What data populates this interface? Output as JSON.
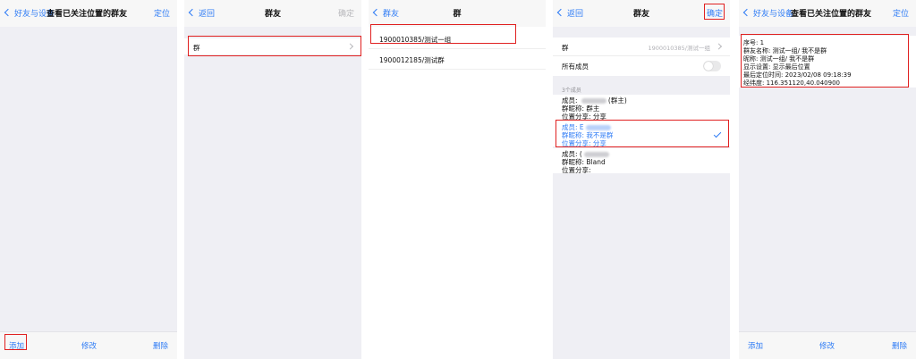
{
  "panel1": {
    "nav": {
      "back": "好友与设备",
      "title": "查看已关注位置的群友",
      "right": "定位"
    },
    "bottom": {
      "add": "添加",
      "edit": "修改",
      "delete": "删除"
    }
  },
  "panel2": {
    "nav": {
      "back": "返回",
      "title": "群友",
      "right": "确定"
    },
    "row_label": "群"
  },
  "panel3": {
    "nav": {
      "back": "群友",
      "title": "群"
    },
    "groups": [
      "1900010385/测试一组",
      "1900012185/测试群"
    ]
  },
  "panel4": {
    "nav": {
      "back": "返回",
      "title": "群友",
      "right": "确定"
    },
    "group_label": "群",
    "group_value": "1900010385/测试一组",
    "all_members_label": "所有成员",
    "member_count": "3个成员",
    "members": [
      {
        "member_prefix": "成员: ",
        "member_suffix": "(群主)",
        "nick": "群昵称: 群主",
        "share": "位置分享: 分享"
      },
      {
        "member_prefix": "成员: E",
        "member_suffix": "",
        "nick": "群昵称: 我不是群",
        "share": "位置分享: 分享"
      },
      {
        "member_prefix": "成员: (",
        "member_suffix": "",
        "nick": "群昵称: Bland",
        "share": "位置分享:"
      }
    ]
  },
  "panel5": {
    "nav": {
      "back": "好友与设备",
      "title": "查看已关注位置的群友",
      "right": "定位"
    },
    "info": {
      "seq": "序号: 1",
      "name": "群友名称: 测试一组/ 我不是群",
      "nick": "昵称: 测试一组/ 我不是群",
      "display": "显示设置: 显示最后位置",
      "last_time": "最后定位时间: 2023/02/08 09:18:39",
      "coords": "经纬度: 116.351120,40.040900"
    },
    "bottom": {
      "add": "添加",
      "edit": "修改",
      "delete": "删除"
    }
  },
  "colors": {
    "accent": "#2f7cf6",
    "highlight": "#e02020",
    "background": "#efeff4"
  }
}
